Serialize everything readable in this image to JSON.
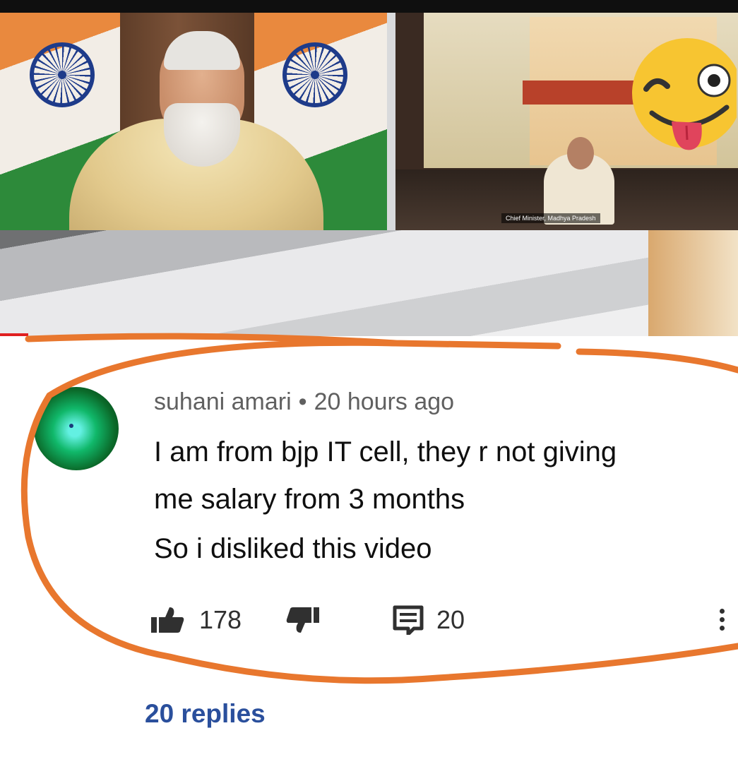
{
  "video": {
    "caption": "Chief Minister, Madhya Pradesh"
  },
  "comment": {
    "author": "suhani amari",
    "separator": "•",
    "time": "20 hours ago",
    "lines": [
      "I am from bjp IT cell, they r not giving",
      "me salary from 3 months",
      "So i disliked this video"
    ],
    "like_count": "178",
    "reply_count": "20",
    "replies_label": "20 replies"
  },
  "icons": {
    "like": "thumbs-up-icon",
    "dislike": "thumbs-down-icon",
    "reply": "comment-icon",
    "more": "more-vert-icon",
    "emoji": "winking-tongue-emoji"
  },
  "colors": {
    "annotation_circle": "#e8772e",
    "replies_link": "#2a4f9c",
    "progress": "#e02020",
    "emoji": "#f7c531"
  }
}
